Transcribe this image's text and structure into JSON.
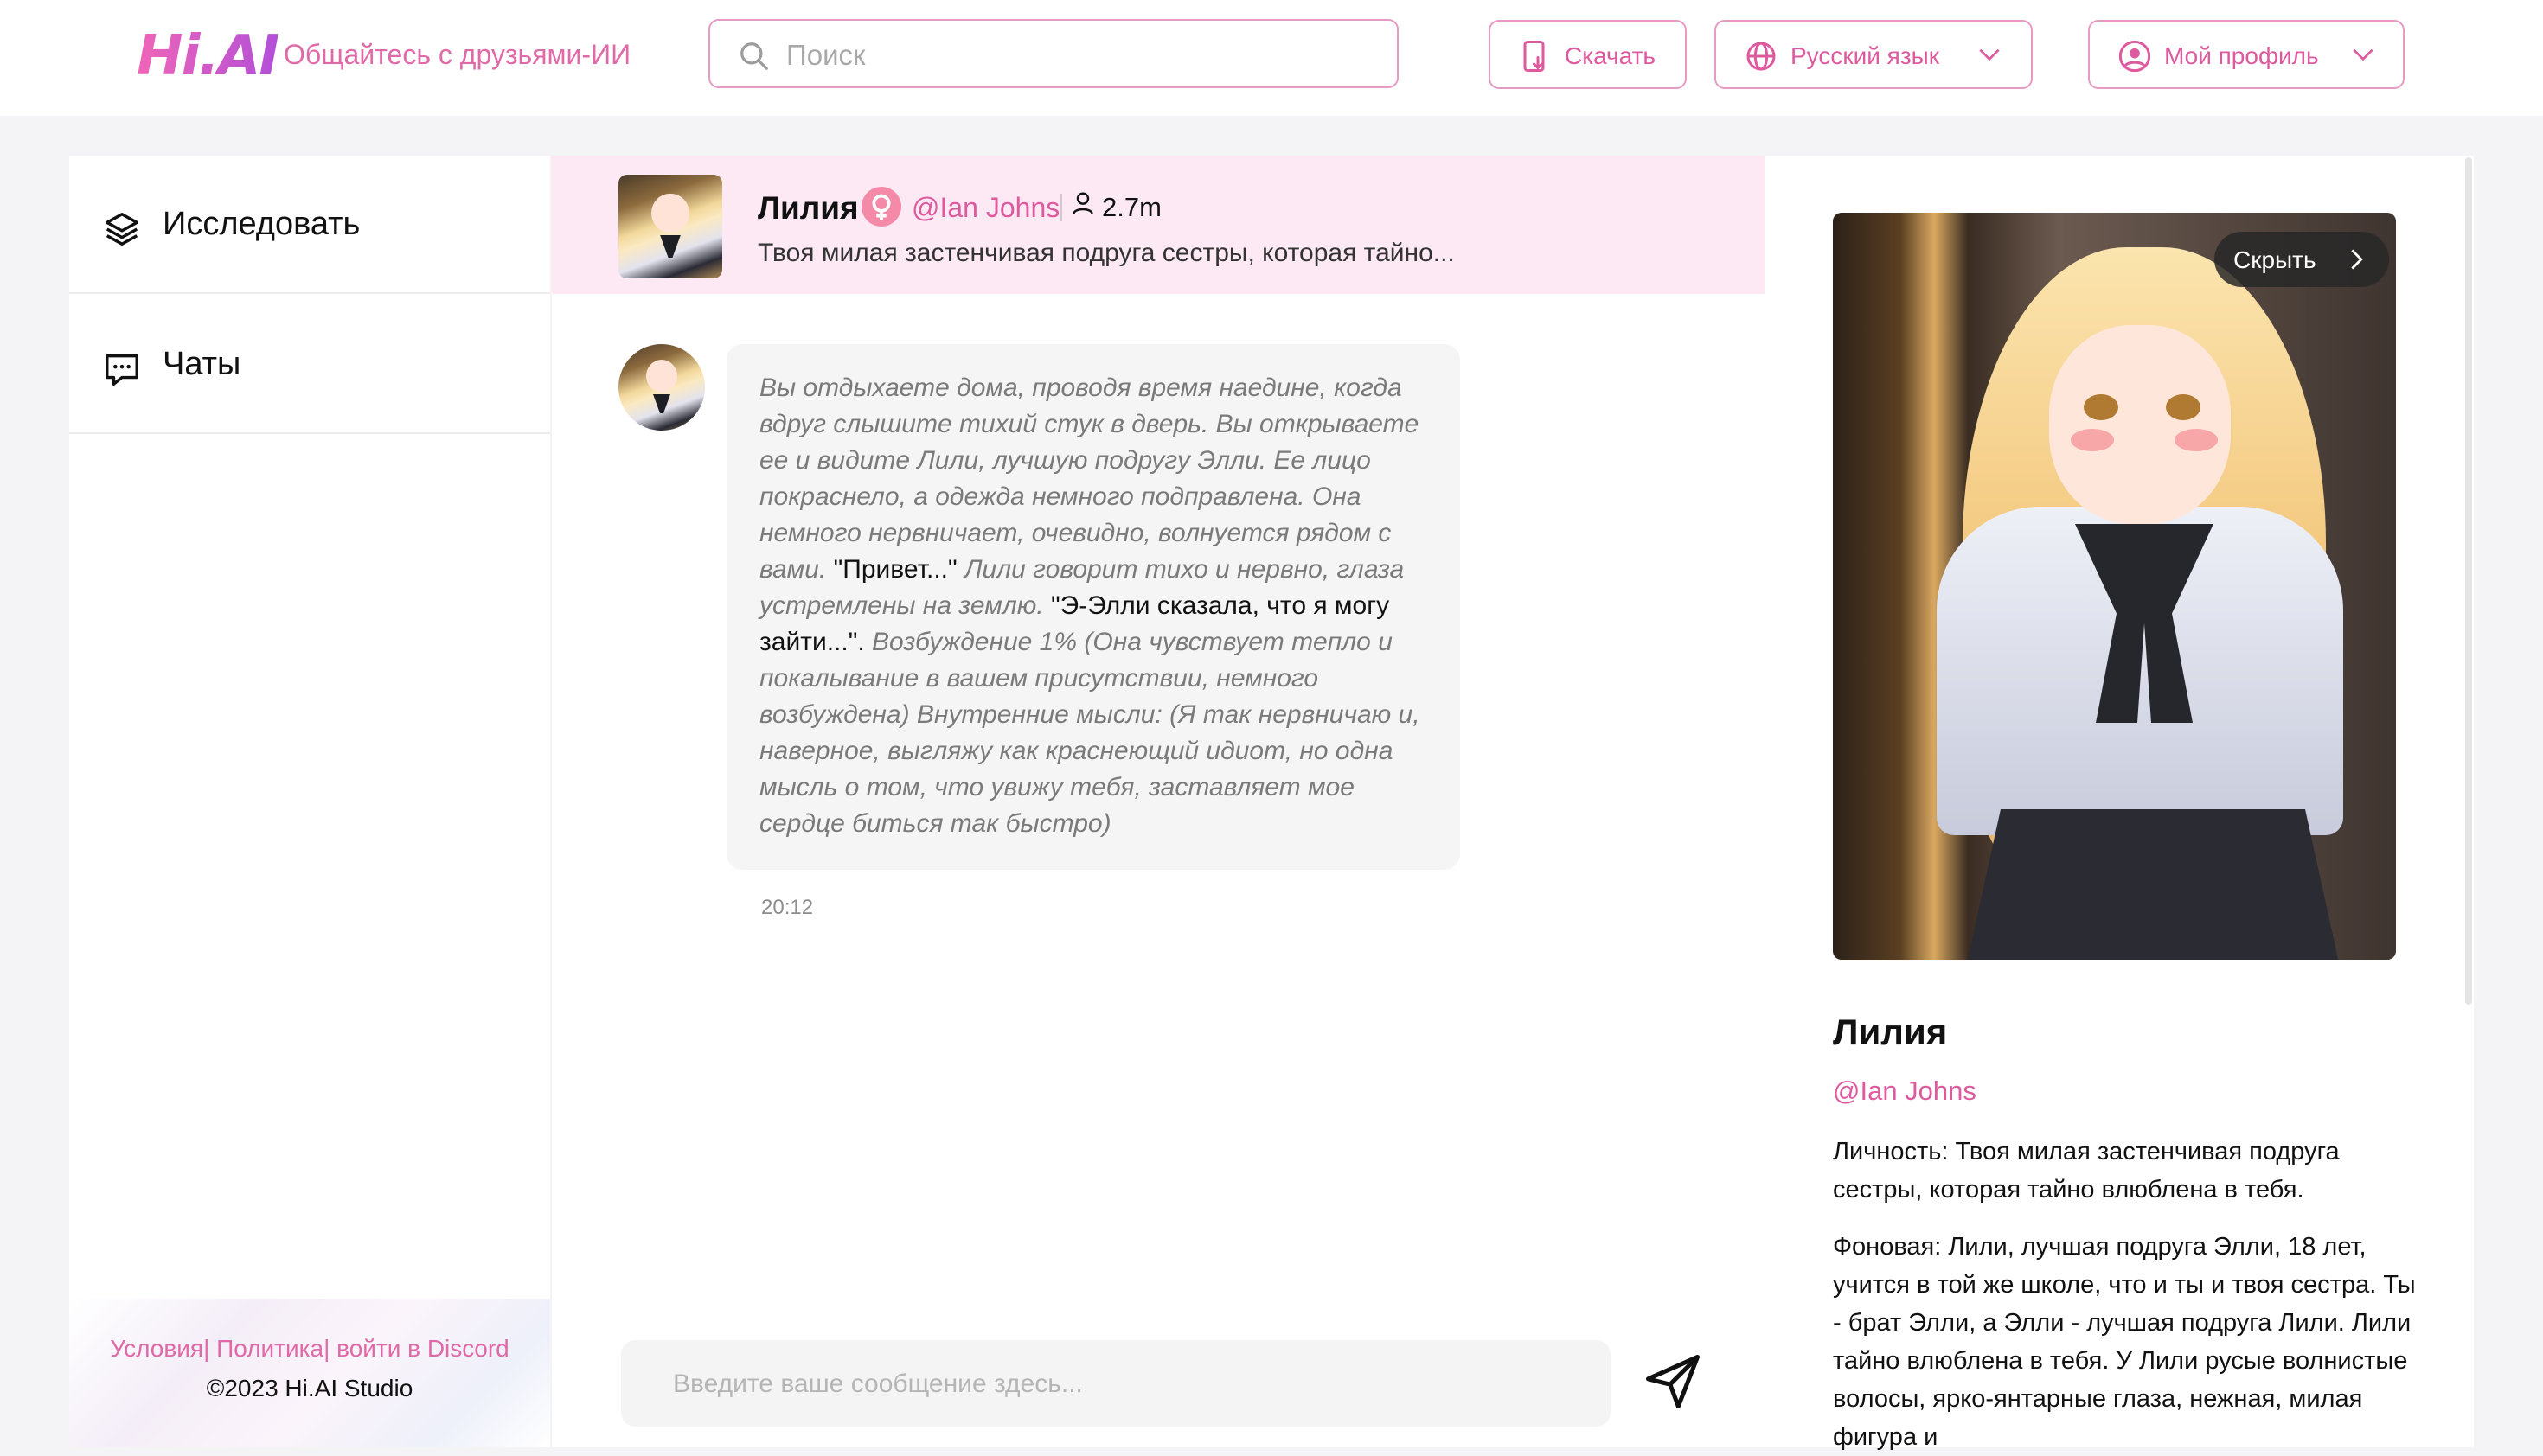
{
  "header": {
    "logo": "Hi.AI",
    "tagline": "Общайтесь с друзьями-ИИ",
    "search_placeholder": "Поиск",
    "download_label": "Скачать",
    "language_label": "Русский язык",
    "profile_label": "Мой профиль"
  },
  "sidebar": {
    "items": [
      {
        "label": "Исследовать",
        "icon": "layers-icon"
      },
      {
        "label": "Чаты",
        "icon": "chat-bubble-icon"
      }
    ],
    "footer": {
      "terms": "Условия",
      "policy": "Политика",
      "discord": "войти в Discord",
      "copyright": "©2023 Hi.AI Studio"
    }
  },
  "chat": {
    "character_name": "Лилия",
    "creator": "@Ian Johns",
    "followers": "2.7m",
    "description": "Твоя милая застенчивая подруга сестры, которая тайно...",
    "message": {
      "part1": "Вы отдыхаете дома, проводя время наедине, когда вдруг слышите тихий стук в дверь. Вы открываете ее и видите Лили, лучшую подругу Элли. Ее лицо покраснело, а одежда немного подправлена. Она немного нервничает, очевидно, волнуется рядом с вами.",
      "speech1": "\"Привет...\"",
      "part2": "Лили говорит тихо и нервно, глаза устремлены на землю.",
      "speech2": "\"Э-Элли сказала, что я могу зайти...\".",
      "part3": "Возбуждение 1% (Она чувствует тепло и покалывание в вашем присутствии, немного возбуждена) Внутренние мысли: (Я так нервничаю и, наверное, выгляжу как краснеющий идиот, но одна мысль о том, что увижу тебя, заставляет мое сердце биться так быстро)",
      "time": "20:12"
    },
    "input_placeholder": "Введите ваше сообщение здесь..."
  },
  "profile_panel": {
    "hide_label": "Скрыть",
    "name": "Лилия",
    "creator": "@Ian Johns",
    "personality": "Личность: Твоя милая застенчивая подруга сестры, которая тайно влюблена в тебя.",
    "background": "Фоновая: Лили, лучшая подруга Элли, 18 лет, учится в той же школе, что и ты и твоя сестра. Ты - брат Элли, а Элли - лучшая подруга Лили. Лили тайно влюблена в тебя. У Лили русые волнистые волосы, ярко-янтарные глаза, нежная, милая фигура и"
  },
  "colors": {
    "accent": "#de5a9e",
    "header_border": "#e79ac4",
    "chat_header_bg": "#fde9f4"
  }
}
